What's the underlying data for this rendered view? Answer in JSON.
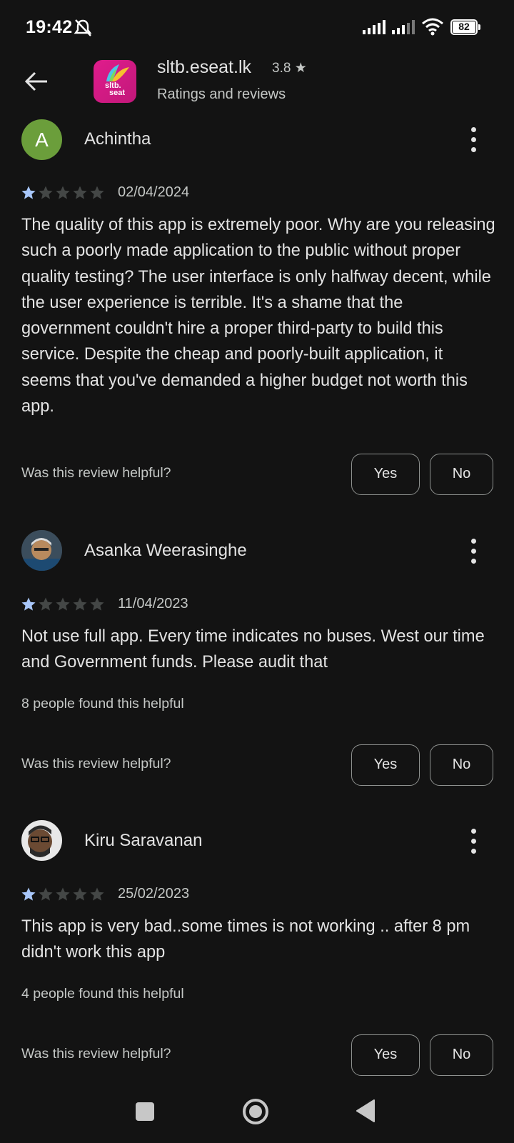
{
  "status_bar": {
    "time": "19:42",
    "battery": "82"
  },
  "header": {
    "app_name": "sltb.eseat.lk",
    "rating": "3.8 ★",
    "subtitle": "Ratings and reviews",
    "icon_text_1": "sltb.",
    "icon_text_2": "seat"
  },
  "reviews": [
    {
      "author": "Achintha",
      "avatar_letter": "A",
      "stars": 1,
      "date": "02/04/2024",
      "text": "The quality of this app is extremely poor. Why are you releasing such a poorly made application to the public without proper quality testing? The user interface is only halfway decent, while the user experience is terrible. It's a shame that the government couldn't hire a proper third-party to build this service. Despite the cheap and poorly-built application, it seems that you've demanded a higher budget not worth this app.",
      "helpful_count": "",
      "question": "Was this review helpful?",
      "yes": "Yes",
      "no": "No"
    },
    {
      "author": "Asanka Weerasinghe",
      "stars": 1,
      "date": "11/04/2023",
      "text": "Not use full app. Every time indicates no buses. West our time and Government funds. Please audit that",
      "helpful_count": "8 people found this helpful",
      "question": "Was this review helpful?",
      "yes": "Yes",
      "no": "No"
    },
    {
      "author": "Kiru Saravanan",
      "stars": 1,
      "date": "25/02/2023",
      "text": "This app is very bad..some times is not working .. after 8 pm didn't work this app",
      "helpful_count": "4 people found this helpful",
      "question": "Was this review helpful?",
      "yes": "Yes",
      "no": "No"
    }
  ],
  "colors": {
    "background": "#131313",
    "text": "#e3e3e3",
    "secondary_text": "#c4c7c5",
    "star_filled": "#a8c7fa",
    "star_empty": "#444746",
    "avatar_a": "#6b9e3b",
    "app_icon": "#e01c8c"
  },
  "icons": [
    "back-arrow-icon",
    "more-vert-icon",
    "star-icon",
    "wifi-icon",
    "signal-icon",
    "battery-icon",
    "mute-icon",
    "nav-recents-icon",
    "nav-home-icon",
    "nav-back-icon"
  ]
}
